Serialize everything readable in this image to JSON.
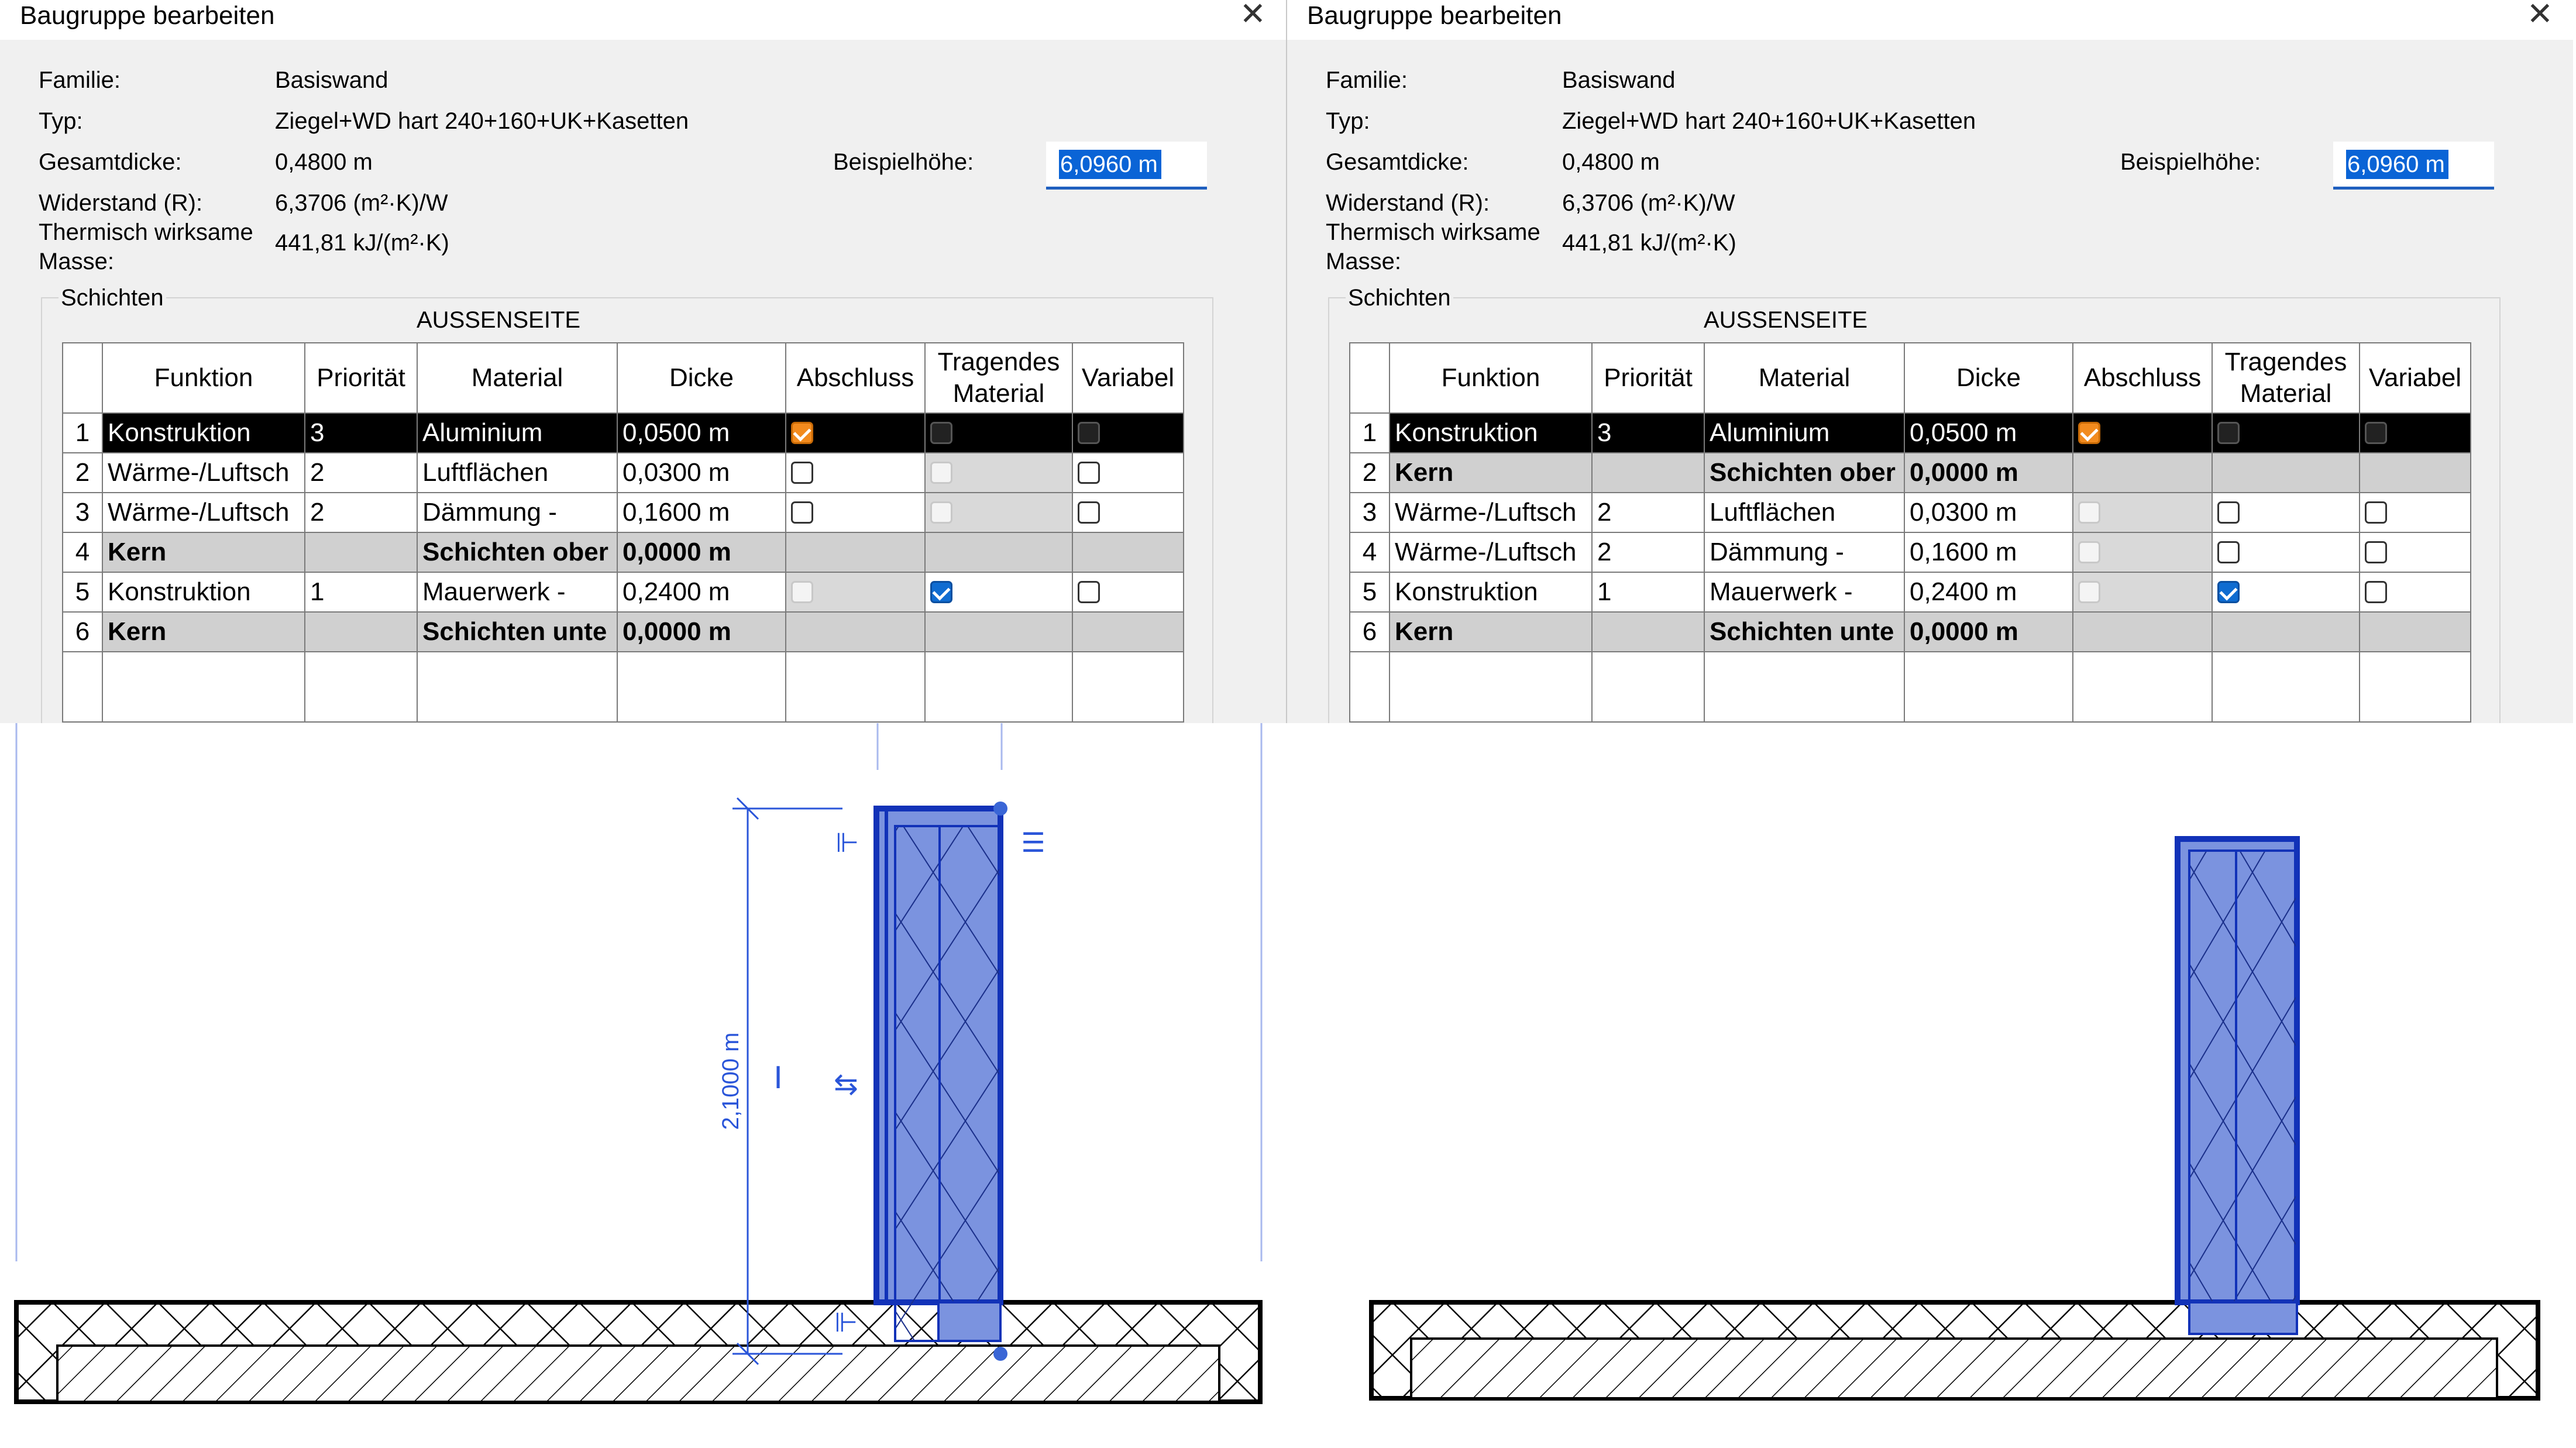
{
  "dialogs": [
    {
      "title": "Baugruppe bearbeiten",
      "close_icon": "close-icon",
      "props": {
        "familie_label": "Familie:",
        "familie": "Basiswand",
        "typ_label": "Typ:",
        "typ": "Ziegel+WD hart 240+160+UK+Kasetten",
        "gesamtdicke_label": "Gesamtdicke:",
        "gesamtdicke": "0,4800 m",
        "widerstand_label": "Widerstand (R):",
        "widerstand": "6,3706 (m²·K)/W",
        "masse_label_1": "Thermisch wirksame",
        "masse_label_2": "Masse:",
        "masse": "441,81 kJ/(m²·K)",
        "beispielhoehe_label": "Beispielhöhe:",
        "beispielhoehe": "6,0960 m"
      },
      "group_label": "Schichten",
      "side_label": "AUSSENSEITE",
      "columns": [
        "Funktion",
        "Priorität",
        "Material",
        "Dicke",
        "Abschluss",
        "Tragendes Material",
        "Variabel"
      ],
      "rows": [
        {
          "num": "1",
          "funktion": "Konstruktion",
          "prioritaet": "3",
          "material": "Aluminium",
          "dicke": "0,0500 m",
          "abschluss": "orange-checked",
          "tragend": "dark",
          "variabel": "unchecked-dark",
          "style": "selected"
        },
        {
          "num": "2",
          "funktion": "Wärme-/Luftsch",
          "prioritaet": "2",
          "material": "Luftflächen",
          "dicke": "0,0300 m",
          "abschluss": "unchecked",
          "tragend": "disabled",
          "variabel": "unchecked",
          "style": "normal"
        },
        {
          "num": "3",
          "funktion": "Wärme-/Luftsch",
          "prioritaet": "2",
          "material": "Dämmung -",
          "dicke": "0,1600 m",
          "abschluss": "unchecked",
          "tragend": "disabled",
          "variabel": "unchecked",
          "style": "normal"
        },
        {
          "num": "4",
          "funktion": "Kern",
          "prioritaet": "",
          "material": "Schichten ober",
          "dicke": "0,0000 m",
          "abschluss": "none",
          "tragend": "none",
          "variabel": "none",
          "style": "core"
        },
        {
          "num": "5",
          "funktion": "Konstruktion",
          "prioritaet": "1",
          "material": "Mauerwerk -",
          "dicke": "0,2400 m",
          "abschluss": "disabled",
          "tragend": "blue-checked",
          "variabel": "unchecked",
          "style": "normal"
        },
        {
          "num": "6",
          "funktion": "Kern",
          "prioritaet": "",
          "material": "Schichten unte",
          "dicke": "0,0000 m",
          "abschluss": "none",
          "tragend": "none",
          "variabel": "none",
          "style": "core"
        }
      ]
    },
    {
      "title": "Baugruppe bearbeiten",
      "close_icon": "close-icon",
      "props": {
        "familie_label": "Familie:",
        "familie": "Basiswand",
        "typ_label": "Typ:",
        "typ": "Ziegel+WD hart 240+160+UK+Kasetten",
        "gesamtdicke_label": "Gesamtdicke:",
        "gesamtdicke": "0,4800 m",
        "widerstand_label": "Widerstand (R):",
        "widerstand": "6,3706 (m²·K)/W",
        "masse_label_1": "Thermisch wirksame",
        "masse_label_2": "Masse:",
        "masse": "441,81 kJ/(m²·K)",
        "beispielhoehe_label": "Beispielhöhe:",
        "beispielhoehe": "6,0960 m"
      },
      "group_label": "Schichten",
      "side_label": "AUSSENSEITE",
      "columns": [
        "Funktion",
        "Priorität",
        "Material",
        "Dicke",
        "Abschluss",
        "Tragendes Material",
        "Variabel"
      ],
      "rows": [
        {
          "num": "1",
          "funktion": "Konstruktion",
          "prioritaet": "3",
          "material": "Aluminium",
          "dicke": "0,0500 m",
          "abschluss": "orange-checked",
          "tragend": "dark",
          "variabel": "unchecked-dark",
          "style": "selected"
        },
        {
          "num": "2",
          "funktion": "Kern",
          "prioritaet": "",
          "material": "Schichten ober",
          "dicke": "0,0000 m",
          "abschluss": "none",
          "tragend": "none",
          "variabel": "none",
          "style": "core"
        },
        {
          "num": "3",
          "funktion": "Wärme-/Luftsch",
          "prioritaet": "2",
          "material": "Luftflächen",
          "dicke": "0,0300 m",
          "abschluss": "disabled",
          "tragend": "unchecked",
          "variabel": "unchecked",
          "style": "normal"
        },
        {
          "num": "4",
          "funktion": "Wärme-/Luftsch",
          "prioritaet": "2",
          "material": "Dämmung -",
          "dicke": "0,1600 m",
          "abschluss": "disabled",
          "tragend": "unchecked",
          "variabel": "unchecked",
          "style": "normal"
        },
        {
          "num": "5",
          "funktion": "Konstruktion",
          "prioritaet": "1",
          "material": "Mauerwerk -",
          "dicke": "0,2400 m",
          "abschluss": "disabled",
          "tragend": "blue-checked",
          "variabel": "unchecked",
          "style": "normal"
        },
        {
          "num": "6",
          "funktion": "Kern",
          "prioritaet": "",
          "material": "Schichten unte",
          "dicke": "0,0000 m",
          "abschluss": "none",
          "tragend": "none",
          "variabel": "none",
          "style": "core"
        }
      ]
    }
  ],
  "drawing_left": {
    "dimension_label": "2,1000 m"
  },
  "colors": {
    "wall_fill": "#7b93df",
    "wall_outline": "#1232b8",
    "dimension": "#2a55d9",
    "selection": "#0a64d6"
  }
}
